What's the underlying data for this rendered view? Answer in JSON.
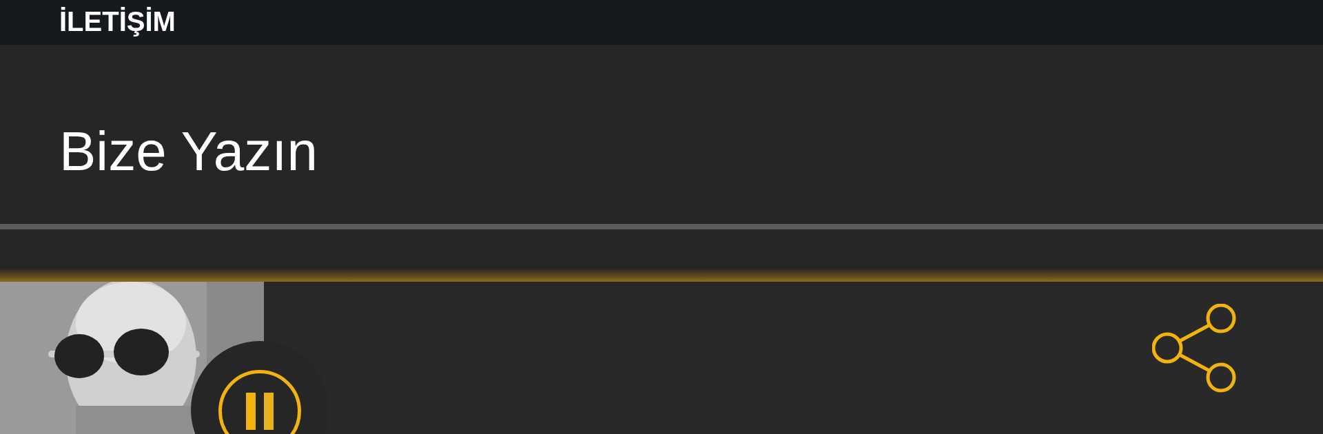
{
  "header": {
    "title": "İLETİŞİM"
  },
  "menu": {
    "items": [
      {
        "label": "Bize Yazın"
      }
    ]
  },
  "player": {
    "playing": true
  }
}
